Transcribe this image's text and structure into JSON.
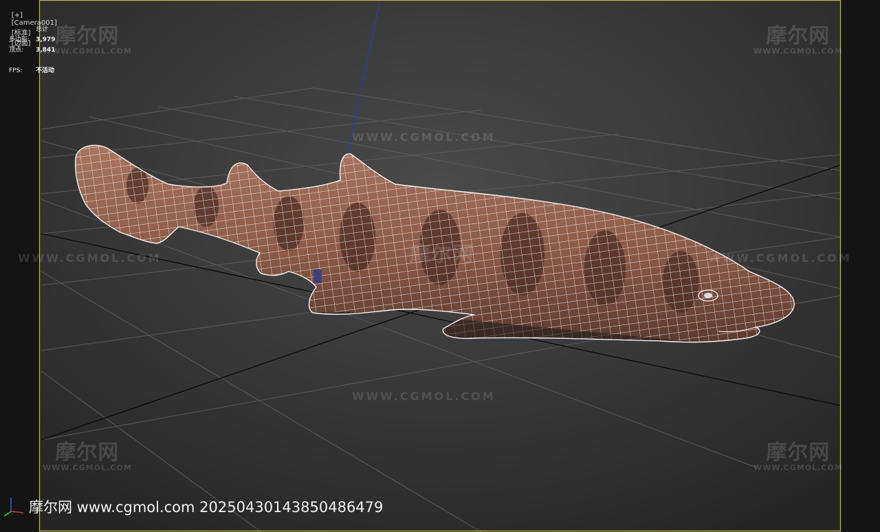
{
  "viewport": {
    "label_parts": [
      "[+]",
      "[Camera001]",
      "[标准]",
      "[边面]"
    ],
    "border_color": "#c8b84a"
  },
  "stats": {
    "total_label": "总计",
    "polygons_label": "多边形:",
    "polygons_value": "3,979",
    "vertices_label": "顶点:",
    "vertices_value": "3,841",
    "fps_label": "FPS:",
    "fps_value": "不活动"
  },
  "watermarks": {
    "brand_cn": "摩尔网",
    "brand_en": "WWW.CGMOL.COM",
    "line_text": "WWW.CGMOL.COM"
  },
  "bottom_watermark": "摩尔网 www.cgmol.com 20250430143850486479",
  "model": {
    "icon": "shark-model-wireframe",
    "skin_color": "#9a6a55"
  }
}
